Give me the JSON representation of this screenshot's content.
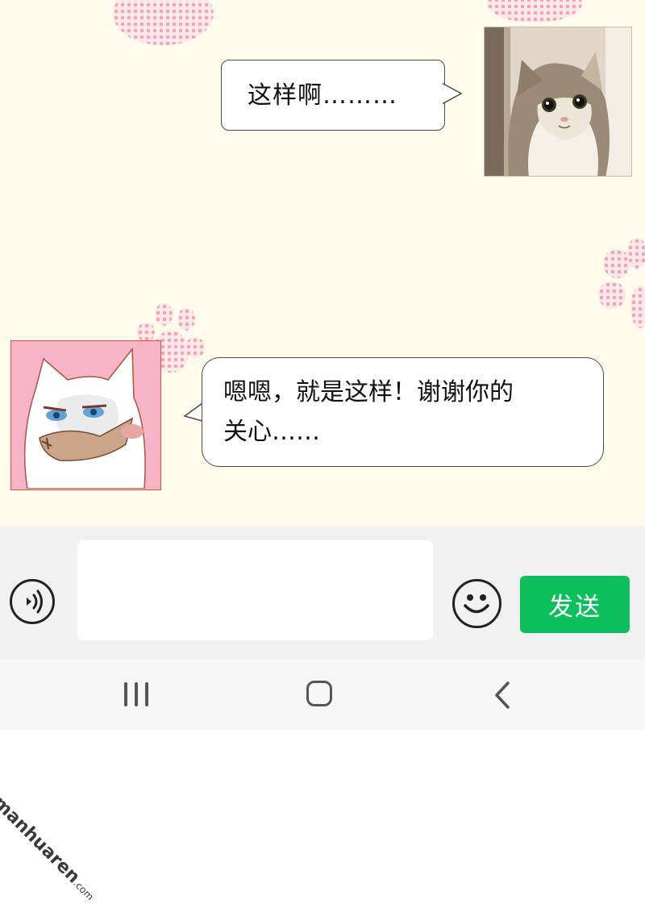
{
  "messages": [
    {
      "side": "right",
      "text": "这样啊………"
    },
    {
      "side": "left",
      "line1": "嗯嗯，就是这样！谢谢你的",
      "line2": "关心……"
    }
  ],
  "input": {
    "value": "",
    "placeholder": ""
  },
  "toolbar": {
    "voice_icon": "voice-wave-icon",
    "emoji_icon": "smile-icon",
    "send_label": "发送",
    "send_color": "#0bbf5c"
  },
  "nav": {
    "recent_icon": "recent-apps-icon",
    "home_icon": "home-icon",
    "back_icon": "back-icon"
  },
  "watermark": {
    "brand": "manhuaren",
    "suffix": ".com"
  },
  "colors": {
    "chat_bg": "#fefbec",
    "paw_pink": "#f3a4b2",
    "avatar_border": "#e0512f"
  }
}
